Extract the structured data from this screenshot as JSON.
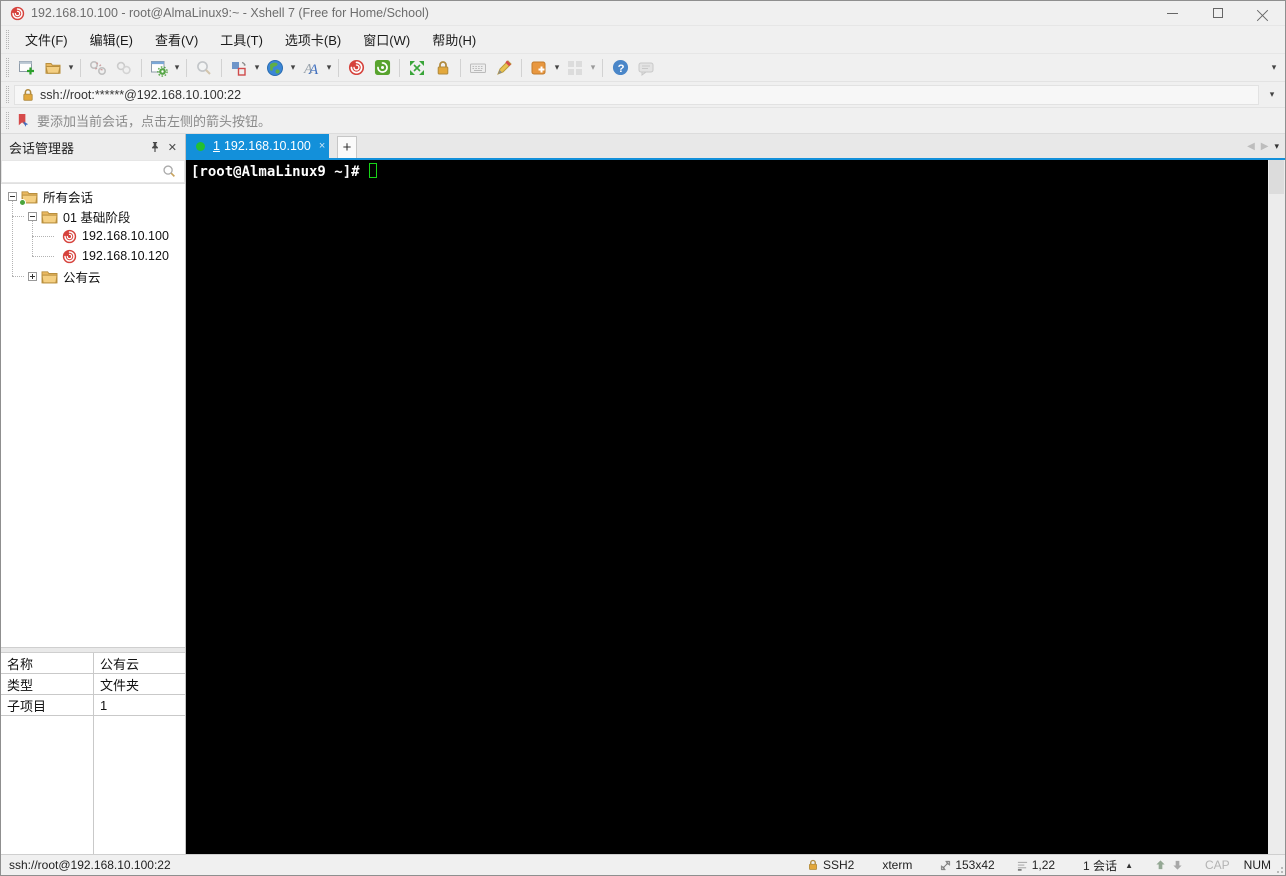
{
  "window": {
    "title": "192.168.10.100 - root@AlmaLinux9:~ - Xshell 7 (Free for Home/School)"
  },
  "glyphs": {
    "caret_down": "▾",
    "close": "✕",
    "tab_close": "×",
    "nav_left": "◀",
    "nav_right": "▶",
    "up_triangle": "▲",
    "up_arrow": "⬆",
    "down_arrow": "⬇"
  },
  "menu": {
    "items": [
      "文件(F)",
      "编辑(E)",
      "查看(V)",
      "工具(T)",
      "选项卡(B)",
      "窗口(W)",
      "帮助(H)"
    ]
  },
  "toolbar": {
    "icons": [
      "new-session-icon",
      "open-icon",
      "disconnect-icon",
      "reconnect-icon",
      "session-properties-icon",
      "find-icon",
      "layout-icon",
      "web-icon",
      "font-icon",
      "xshell-icon",
      "xftp-icon",
      "fullscreen-icon",
      "lock-icon",
      "virtual-keyboard-icon",
      "compose-icon",
      "new-tab-icon",
      "tile-icon",
      "help-icon",
      "feedback-icon"
    ]
  },
  "address_bar": {
    "value": "ssh://root:******@192.168.10.100:22"
  },
  "notification": {
    "text": "要添加当前会话，点击左侧的箭头按钮。"
  },
  "session_manager": {
    "title": "会话管理器",
    "search_value": "",
    "tree": [
      {
        "label": "所有会话",
        "icon": "root-folder-icon",
        "state": "expanded"
      },
      {
        "label": "01 基础阶段",
        "icon": "folder-icon",
        "state": "expanded"
      },
      {
        "label": "192.168.10.100",
        "icon": "session-icon"
      },
      {
        "label": "192.168.10.120",
        "icon": "session-icon"
      },
      {
        "label": "公有云",
        "icon": "folder-icon",
        "state": "collapsed"
      }
    ]
  },
  "properties": {
    "rows": [
      {
        "label": "名称",
        "value": "公有云"
      },
      {
        "label": "类型",
        "value": "文件夹"
      },
      {
        "label": "子项目",
        "value": "1"
      }
    ]
  },
  "tab_bar": {
    "active_tab": {
      "index": "1",
      "label": "192.168.10.100"
    },
    "new_tab": "+"
  },
  "terminal": {
    "prompt": "[root@AlmaLinux9 ~]#"
  },
  "status_bar": {
    "url": "ssh://root@192.168.10.100:22",
    "protocol": "SSH2",
    "terminal_type": "xterm",
    "screen_size": "153x42",
    "cursor_position": "1,22",
    "session_count": "1 会话",
    "cap": "CAP",
    "num": "NUM"
  },
  "colors": {
    "accent_blue": "#1390da",
    "terminal_green": "#17d417",
    "xshell_red": "#d6423c",
    "folder_gold": "#f2c25e"
  }
}
